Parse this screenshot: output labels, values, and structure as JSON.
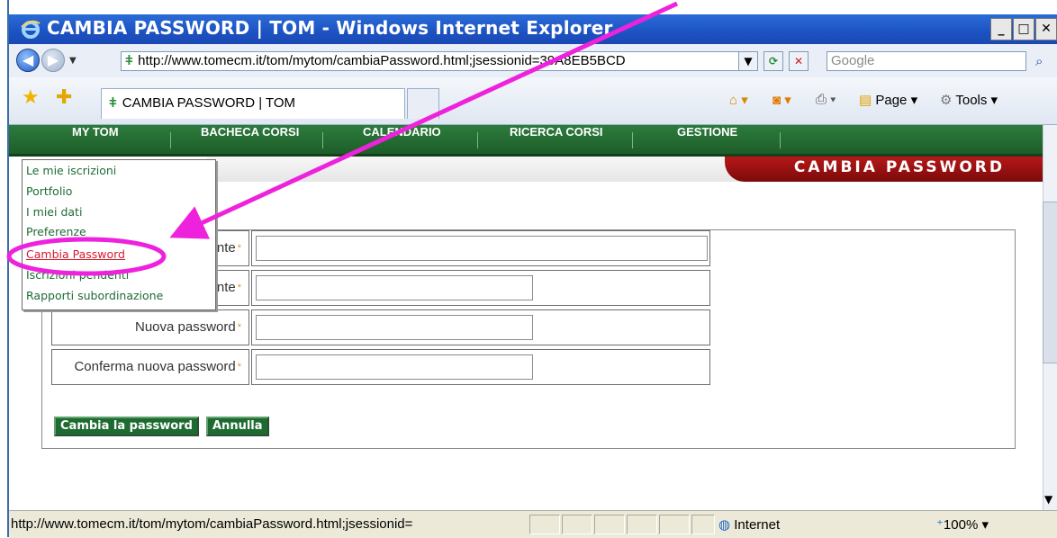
{
  "window": {
    "title": "CAMBIA PASSWORD | TOM - Windows Internet Explorer",
    "minimize": "_",
    "restore": "□",
    "close": "✕"
  },
  "address": {
    "url": "http://www.tomecm.it/tom/mytom/cambiaPassword.html;jsessionid=39A8EB5BCD",
    "search_placeholder": "Google"
  },
  "toolbar": {
    "tab_title": "CAMBIA PASSWORD | TOM",
    "page_label": "Page",
    "tools_label": "Tools"
  },
  "site_menu": {
    "items": [
      "MY TOM",
      "BACHECA CORSI",
      "CALENDARIO",
      "RICERCA CORSI",
      "GESTIONE"
    ]
  },
  "header": {
    "title": "CAMBIA PASSWORD"
  },
  "dropdown": {
    "items": [
      "Le mie iscrizioni",
      "Portfolio",
      "I miei dati",
      "Preferenze",
      "Cambia Password",
      "Iscrizioni pendenti",
      "Rapporti subordinazione"
    ],
    "active": "Cambia Password"
  },
  "form": {
    "row1_label_fragment": "nte",
    "row2_label_fragment": "nte",
    "new_password_label": "Nuova password",
    "confirm_password_label": "Conferma nuova password",
    "required_marker": "*",
    "submit_label": "Cambia la password",
    "cancel_label": "Annulla"
  },
  "status": {
    "text": "http://www.tomecm.it/tom/mytom/cambiaPassword.html;jsessionid=",
    "zone": "Internet",
    "zoom": "100%"
  },
  "colors": {
    "menu_green": "#1e5d2a",
    "header_red": "#a01414",
    "annotation_magenta": "#ee22dd",
    "link_green": "#1f6b35",
    "active_red": "#d7192f"
  }
}
